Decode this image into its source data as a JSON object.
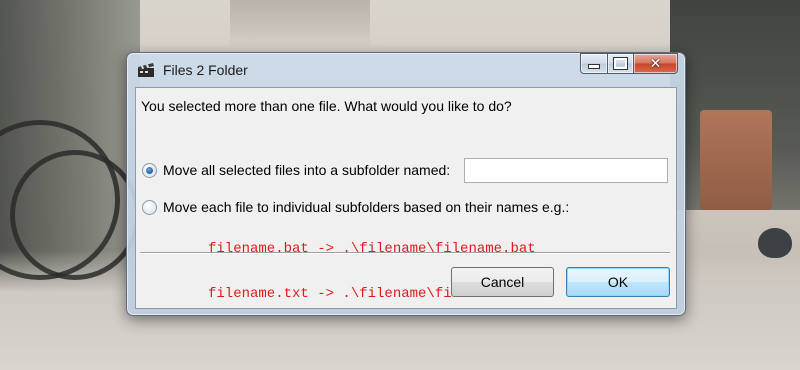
{
  "window": {
    "title": "Files 2 Folder",
    "icon": "clapperboard-icon",
    "caption_buttons": {
      "minimize": "minimize-icon",
      "maximize": "maximize-icon",
      "close": "close-icon"
    }
  },
  "dialog": {
    "prompt": "You selected more than one file.  What would you like to do?",
    "option_subfolder": {
      "label": "Move all selected files into a subfolder named:",
      "selected": true,
      "input_value": "",
      "input_placeholder": ""
    },
    "option_individual": {
      "label": "Move each file to individual subfolders based on their names e.g.:",
      "selected": false
    },
    "examples": [
      "filename.bat -> .\\filename\\filename.bat",
      "filename.txt -> .\\filename\\filename.txt"
    ],
    "example_color": "#e01b1b",
    "buttons": {
      "cancel": "Cancel",
      "ok": "OK"
    }
  }
}
